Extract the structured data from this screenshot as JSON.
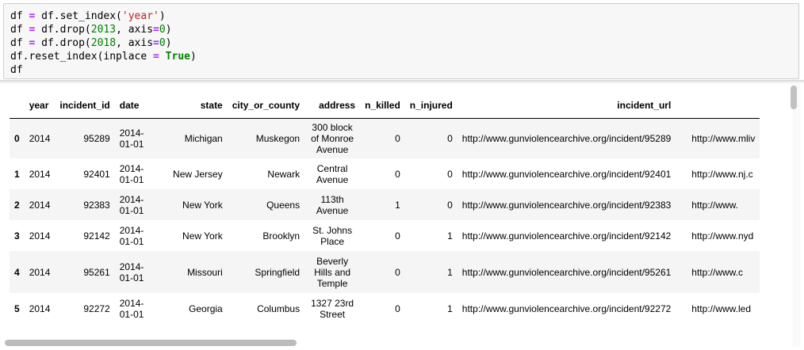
{
  "code": {
    "lines": [
      [
        [
          "df",
          ""
        ],
        [
          " ",
          ""
        ],
        [
          "=",
          "op"
        ],
        [
          " df.set_index(",
          ""
        ],
        [
          "'year'",
          "str"
        ],
        [
          ")",
          ""
        ]
      ],
      [
        [
          "df",
          ""
        ],
        [
          " ",
          ""
        ],
        [
          "=",
          "op"
        ],
        [
          " df.drop(",
          ""
        ],
        [
          "2013",
          "num"
        ],
        [
          ", axis",
          ""
        ],
        [
          "=",
          "op"
        ],
        [
          "0",
          "num"
        ],
        [
          ")",
          ""
        ]
      ],
      [
        [
          "df",
          ""
        ],
        [
          " ",
          ""
        ],
        [
          "=",
          "op"
        ],
        [
          " df.drop(",
          ""
        ],
        [
          "2018",
          "num"
        ],
        [
          ", axis",
          ""
        ],
        [
          "=",
          "op"
        ],
        [
          "0",
          "num"
        ],
        [
          ")",
          ""
        ]
      ],
      [
        [
          "df.reset_index(inplace ",
          ""
        ],
        [
          "=",
          "op"
        ],
        [
          " ",
          ""
        ],
        [
          "True",
          "bool"
        ],
        [
          ")",
          ""
        ]
      ],
      [
        [
          "df",
          ""
        ]
      ]
    ]
  },
  "table": {
    "columns": [
      "",
      "year",
      "incident_id",
      "date",
      "state",
      "city_or_county",
      "address",
      "n_killed",
      "n_injured",
      "incident_url",
      ""
    ],
    "rows": [
      {
        "idx": "0",
        "year": "2014",
        "incident_id": "95289",
        "date": "2014-01-01",
        "state": "Michigan",
        "city": "Muskegon",
        "address": "300 block of Monroe Avenue",
        "n_killed": "0",
        "n_injured": "0",
        "url": "http://www.gunviolencearchive.org/incident/95289",
        "url2": "http://www.mliv"
      },
      {
        "idx": "1",
        "year": "2014",
        "incident_id": "92401",
        "date": "2014-01-01",
        "state": "New Jersey",
        "city": "Newark",
        "address": "Central Avenue",
        "n_killed": "0",
        "n_injured": "0",
        "url": "http://www.gunviolencearchive.org/incident/92401",
        "url2": "http://www.nj.c"
      },
      {
        "idx": "2",
        "year": "2014",
        "incident_id": "92383",
        "date": "2014-01-01",
        "state": "New York",
        "city": "Queens",
        "address": "113th Avenue",
        "n_killed": "1",
        "n_injured": "0",
        "url": "http://www.gunviolencearchive.org/incident/92383",
        "url2": "http://www."
      },
      {
        "idx": "3",
        "year": "2014",
        "incident_id": "92142",
        "date": "2014-01-01",
        "state": "New York",
        "city": "Brooklyn",
        "address": "St. Johns Place",
        "n_killed": "0",
        "n_injured": "1",
        "url": "http://www.gunviolencearchive.org/incident/92142",
        "url2": "http://www.nyd"
      },
      {
        "idx": "4",
        "year": "2014",
        "incident_id": "95261",
        "date": "2014-01-01",
        "state": "Missouri",
        "city": "Springfield",
        "address": "Beverly Hills and Temple",
        "n_killed": "0",
        "n_injured": "1",
        "url": "http://www.gunviolencearchive.org/incident/95261",
        "url2": "http://www.c"
      },
      {
        "idx": "5",
        "year": "2014",
        "incident_id": "92272",
        "date": "2014-01-01",
        "state": "Georgia",
        "city": "Columbus",
        "address": "1327 23rd Street",
        "n_killed": "0",
        "n_injured": "1",
        "url": "http://www.gunviolencearchive.org/incident/92272",
        "url2": "http://www.led"
      }
    ]
  }
}
